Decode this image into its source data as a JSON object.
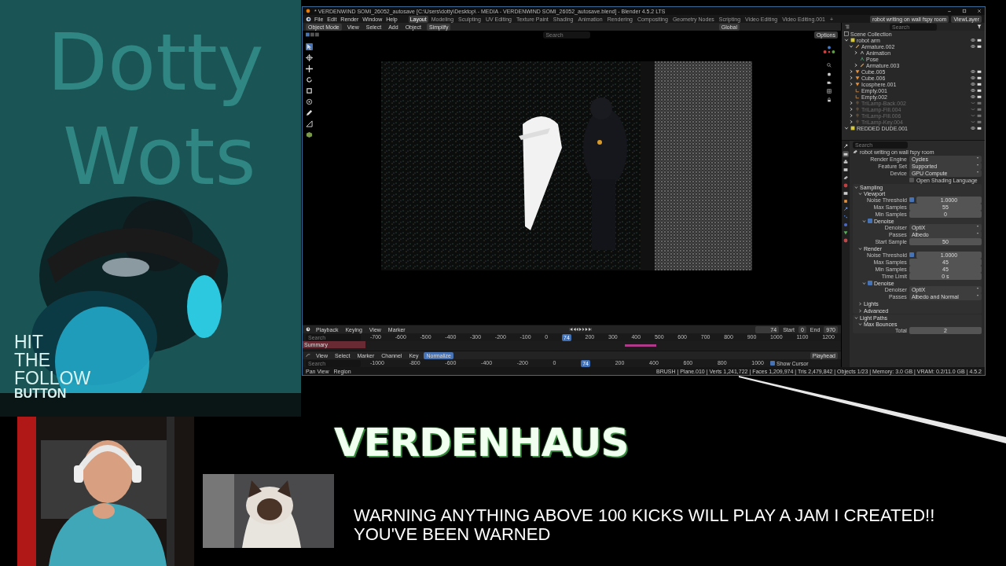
{
  "overlay": {
    "background_text": [
      "Dotty",
      "Wots"
    ],
    "follow_prompt": [
      "HIT",
      "THE",
      "FOLLOW",
      "BUTTON"
    ]
  },
  "blender": {
    "title": "* VERDENWIND SOMI_26052_autosave [C:\\Users\\dotty\\Desktop\\ - MEDIA - VERDENWIND SOMI_26052_autosave.blend] - Blender 4.5.2 LTS",
    "menus": [
      "File",
      "Edit",
      "Render",
      "Window",
      "Help"
    ],
    "workspaces": [
      {
        "label": "Layout",
        "selected": true
      },
      {
        "label": "Modeling",
        "selected": false
      },
      {
        "label": "Sculpting",
        "selected": false
      },
      {
        "label": "UV Editing",
        "selected": false
      },
      {
        "label": "Texture Paint",
        "selected": false
      },
      {
        "label": "Shading",
        "selected": false
      },
      {
        "label": "Animation",
        "selected": false
      },
      {
        "label": "Rendering",
        "selected": false
      },
      {
        "label": "Compositing",
        "selected": false
      },
      {
        "label": "Geometry Nodes",
        "selected": false
      },
      {
        "label": "Scripting",
        "selected": false
      },
      {
        "label": "Video Editing",
        "selected": false
      },
      {
        "label": "Video Editing.001",
        "selected": false
      },
      {
        "label": "+",
        "selected": false
      }
    ],
    "scene": "robot writing on wall fspy room",
    "view_layer": "ViewLayer",
    "viewport_header": {
      "mode": "Object Mode",
      "menus": [
        "View",
        "Select",
        "Add",
        "Object"
      ],
      "simplify": "Simplify",
      "orientation": "Global",
      "search_placeholder": "Search",
      "options": "Options"
    },
    "outliner": {
      "search_placeholder": "Search",
      "root": "Scene Collection",
      "tree": [
        {
          "label": "robot arm",
          "kind": "collection",
          "expanded": true,
          "hidden": false,
          "children": [
            {
              "label": "Armature.002",
              "kind": "armature",
              "expanded": true,
              "hidden": false,
              "children": [
                {
                  "label": "Animation",
                  "kind": "action",
                  "expanded": false
                },
                {
                  "label": "Pose",
                  "kind": "pose"
                },
                {
                  "label": "Armature.003",
                  "kind": "armature",
                  "expanded": false
                }
              ]
            },
            {
              "label": "Cube.005",
              "kind": "mesh",
              "expanded": false,
              "hidden": false
            },
            {
              "label": "Cube.006",
              "kind": "mesh",
              "expanded": false,
              "hidden": false
            },
            {
              "label": "Icosphere.001",
              "kind": "mesh",
              "expanded": false,
              "hidden": false
            },
            {
              "label": "Empty.001",
              "kind": "empty",
              "hidden": false
            },
            {
              "label": "Empty.002",
              "kind": "empty",
              "hidden": false
            },
            {
              "label": "TriLamp-Back.002",
              "kind": "light",
              "expanded": false,
              "hidden": true
            },
            {
              "label": "TriLamp-Fill.004",
              "kind": "light",
              "expanded": false,
              "hidden": true
            },
            {
              "label": "TriLamp-Fill.006",
              "kind": "light",
              "expanded": false,
              "hidden": true
            },
            {
              "label": "TriLamp-Key.004",
              "kind": "light",
              "expanded": false,
              "hidden": true
            }
          ]
        },
        {
          "label": "REDDED DUDE.001",
          "kind": "collection",
          "expanded": true,
          "hidden": false
        }
      ]
    },
    "properties": {
      "tabs": [
        {
          "selected": false
        },
        {
          "selected": true
        },
        {
          "selected": false
        },
        {
          "selected": false
        },
        {
          "selected": false
        },
        {
          "selected": false
        },
        {
          "selected": false
        },
        {
          "selected": false
        },
        {
          "selected": false
        },
        {
          "selected": false
        },
        {
          "selected": false
        },
        {
          "selected": false
        },
        {
          "selected": false
        }
      ],
      "search_placeholder": "Search",
      "scene": "robot writing on wall fspy room",
      "rows": [
        {
          "kind": "dropdown",
          "label": "Render Engine",
          "value": "Cycles"
        },
        {
          "kind": "dropdown",
          "label": "Feature Set",
          "value": "Supported"
        },
        {
          "kind": "dropdown",
          "label": "Device",
          "value": "GPU Compute"
        },
        {
          "kind": "check",
          "label": "Open Shading Language",
          "checked": false
        },
        {
          "kind": "panel",
          "label": "Sampling",
          "expanded": true,
          "children": [
            {
              "kind": "panel",
              "label": "Viewport",
              "expanded": true,
              "children": [
                {
                  "kind": "field",
                  "label": "Noise Threshold",
                  "checked": true,
                  "value": "1.0000"
                },
                {
                  "kind": "field",
                  "label": "Max Samples",
                  "value": "55"
                },
                {
                  "kind": "field",
                  "label": "Min Samples",
                  "value": "0"
                },
                {
                  "kind": "panel",
                  "label": "Denoise",
                  "checked": true,
                  "expanded": true,
                  "children": [
                    {
                      "kind": "dropdown",
                      "label": "Denoiser",
                      "value": "OptiX"
                    },
                    {
                      "kind": "dropdown",
                      "label": "Passes",
                      "value": "Albedo"
                    },
                    {
                      "kind": "field",
                      "label": "Start Sample",
                      "value": "50"
                    }
                  ]
                }
              ]
            },
            {
              "kind": "panel",
              "label": "Render",
              "expanded": true,
              "children": [
                {
                  "kind": "field",
                  "label": "Noise Threshold",
                  "checked": true,
                  "value": "1.0000"
                },
                {
                  "kind": "field",
                  "label": "Max Samples",
                  "value": "45"
                },
                {
                  "kind": "field",
                  "label": "Min Samples",
                  "value": "45"
                },
                {
                  "kind": "field",
                  "label": "Time Limit",
                  "value": "0 s"
                },
                {
                  "kind": "panel",
                  "label": "Denoise",
                  "checked": true,
                  "expanded": true,
                  "children": [
                    {
                      "kind": "dropdown",
                      "label": "Denoiser",
                      "value": "OptiX"
                    },
                    {
                      "kind": "dropdown",
                      "label": "Passes",
                      "value": "Albedo and Normal"
                    }
                  ]
                }
              ]
            },
            {
              "kind": "panel",
              "label": "Lights",
              "expanded": false
            },
            {
              "kind": "panel",
              "label": "Advanced",
              "expanded": false
            }
          ]
        },
        {
          "kind": "panel",
          "label": "Light Paths",
          "expanded": true,
          "children": [
            {
              "kind": "panel",
              "label": "Max Bounces",
              "expanded": true,
              "children": [
                {
                  "kind": "field",
                  "label": "Total",
                  "value": "2"
                }
              ]
            }
          ]
        }
      ]
    },
    "timeline": {
      "menus": [
        "Playback",
        "Keying",
        "View",
        "Marker"
      ],
      "frame": "74",
      "start_label": "Start",
      "start": "0",
      "end_label": "End",
      "end": "970",
      "search_placeholder": "Search",
      "channel": "Summary",
      "ticks": [
        {
          "label": "-700"
        },
        {
          "label": "-600"
        },
        {
          "label": "-500"
        },
        {
          "label": "-400"
        },
        {
          "label": "-300"
        },
        {
          "label": "-200"
        },
        {
          "label": "-100"
        },
        {
          "label": "0"
        },
        {
          "label": "74",
          "kind": "playhead"
        },
        {
          "label": "200"
        },
        {
          "label": "300"
        },
        {
          "label": "400"
        },
        {
          "label": "500"
        },
        {
          "label": "600"
        },
        {
          "label": "700"
        },
        {
          "label": "800"
        },
        {
          "label": "900"
        },
        {
          "label": "1000"
        },
        {
          "label": "1100"
        },
        {
          "label": "1200"
        }
      ]
    },
    "graph_editor": {
      "menus": [
        "View",
        "Select",
        "Marker",
        "Channel",
        "Key"
      ],
      "normalize": {
        "label": "Normalize",
        "on": true
      },
      "pivot": "Playhead",
      "search_placeholder": "Search",
      "show_cursor": {
        "label": "Show Cursor",
        "checked": true
      },
      "ticks": [
        {
          "label": "-1000"
        },
        {
          "label": "-800"
        },
        {
          "label": "-600"
        },
        {
          "label": "-400"
        },
        {
          "label": "-200"
        },
        {
          "label": "0"
        },
        {
          "label": "74",
          "kind": "playhead"
        },
        {
          "label": "200"
        },
        {
          "label": "400"
        },
        {
          "label": "600"
        },
        {
          "label": "800"
        },
        {
          "label": "1000"
        }
      ]
    },
    "status_bar": {
      "left": [
        "Pan View",
        "Region"
      ],
      "right": "BRUSH | Plane.010 | Verts 1,241,722 | Faces 1,209,974 | Tris 2,479,842 | Objects 1/23 | Memory: 3.0 GB | VRAM: 0.2/11.0 GB | 4.5.2"
    }
  },
  "logo": "VERDENHAUS",
  "warning": [
    "WARNING ANYTHING ABOVE 100 KICKS WILL PLAY A JAM I CREATED!!",
    "YOU'VE BEEN WARNED"
  ]
}
